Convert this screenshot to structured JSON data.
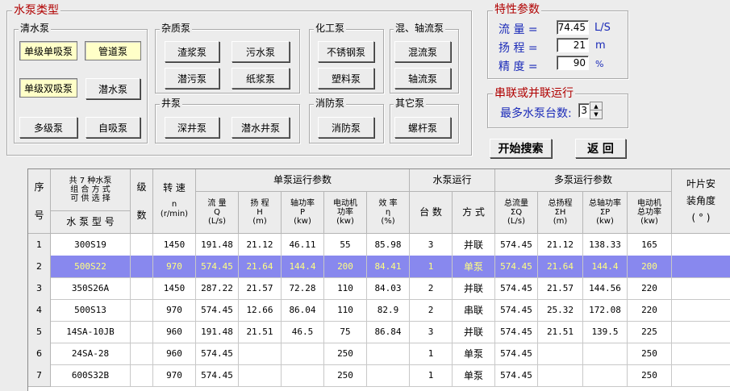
{
  "type_group": {
    "title": "水泵类型",
    "clear_water": {
      "title": "清水泵",
      "buttons": [
        "单级单吸泵",
        "管道泵",
        "单级双吸泵",
        "潜水泵",
        "多级泵",
        "自吸泵"
      ]
    },
    "impurity": {
      "title": "杂质泵",
      "buttons": [
        "渣浆泵",
        "污水泵",
        "潜污泵",
        "纸浆泵"
      ]
    },
    "chemical": {
      "title": "化工泵",
      "buttons": [
        "不锈钢泵",
        "塑料泵"
      ]
    },
    "mixed_flow": {
      "title": "混、轴流泵",
      "buttons": [
        "混流泵",
        "轴流泵"
      ]
    },
    "well": {
      "title": "井泵",
      "buttons": [
        "深井泵",
        "潜水井泵"
      ]
    },
    "fire": {
      "title": "消防泵",
      "buttons": [
        "消防泵"
      ]
    },
    "other": {
      "title": "其它泵",
      "buttons": [
        "螺杆泵"
      ]
    }
  },
  "params": {
    "title": "特性参数",
    "flow_label": "流  量 =",
    "flow_value": "74.45",
    "flow_unit": "L/S",
    "head_label": "扬  程 =",
    "head_value": "21",
    "head_unit": "m",
    "accuracy_label": "精  度 =",
    "accuracy_value": "90",
    "accuracy_unit": "%"
  },
  "series": {
    "title": "串联或并联运行",
    "max_label": "最多水泵台数:",
    "max_value": "3"
  },
  "actions": {
    "search": "开始搜索",
    "back": "返  回"
  },
  "table": {
    "headers": {
      "seq_top": "序",
      "seq_bottom": "号",
      "combo_top": "共 7 种水泵\n组 合 方 式\n可 供 选 择",
      "model": "水 泵 型 号",
      "stage_top": "级",
      "stage_bottom": "数",
      "speed_top": "转  速",
      "speed_bottom": "n\n(r/min)",
      "single": "单泵运行参数",
      "flow": "流  量\nQ\n(L/s)",
      "head": "扬  程\nH\n(m)",
      "shaft": "轴功率\nP\n(kw)",
      "motor": "电动机\n功率\n(kw)",
      "eff": "效  率\nη\n(%)",
      "run": "水泵运行",
      "count": "台  数",
      "mode": "方  式",
      "multi": "多泵运行参数",
      "tflow": "总流量\nΣQ\n(L/s)",
      "thead": "总扬程\nΣH\n(m)",
      "tshaft": "总轴功率\nΣP\n(kw)",
      "tmotor": "电动机\n总功率\n(kw)",
      "blade_top": "叶片安",
      "blade_mid": "装角度",
      "blade_bottom": "( ° )"
    },
    "rows": [
      {
        "no": "1",
        "model": "300S19",
        "stage": "",
        "speed": "1450",
        "q": "191.48",
        "h": "21.12",
        "p": "46.11",
        "motor": "55",
        "eff": "85.98",
        "count": "3",
        "mode": "并联",
        "tq": "574.45",
        "th": "21.12",
        "tp": "138.33",
        "tm": "165",
        "blade": ""
      },
      {
        "no": "2",
        "model": "500S22",
        "stage": "",
        "speed": "970",
        "q": "574.45",
        "h": "21.64",
        "p": "144.4",
        "motor": "200",
        "eff": "84.41",
        "count": "1",
        "mode": "单泵",
        "tq": "574.45",
        "th": "21.64",
        "tp": "144.4",
        "tm": "200",
        "blade": ""
      },
      {
        "no": "3",
        "model": "350S26A",
        "stage": "",
        "speed": "1450",
        "q": "287.22",
        "h": "21.57",
        "p": "72.28",
        "motor": "110",
        "eff": "84.03",
        "count": "2",
        "mode": "并联",
        "tq": "574.45",
        "th": "21.57",
        "tp": "144.56",
        "tm": "220",
        "blade": ""
      },
      {
        "no": "4",
        "model": "500S13",
        "stage": "",
        "speed": "970",
        "q": "574.45",
        "h": "12.66",
        "p": "86.04",
        "motor": "110",
        "eff": "82.9",
        "count": "2",
        "mode": "串联",
        "tq": "574.45",
        "th": "25.32",
        "tp": "172.08",
        "tm": "220",
        "blade": ""
      },
      {
        "no": "5",
        "model": "14SA-10JB",
        "stage": "",
        "speed": "960",
        "q": "191.48",
        "h": "21.51",
        "p": "46.5",
        "motor": "75",
        "eff": "86.84",
        "count": "3",
        "mode": "并联",
        "tq": "574.45",
        "th": "21.51",
        "tp": "139.5",
        "tm": "225",
        "blade": ""
      },
      {
        "no": "6",
        "model": "24SA-28",
        "stage": "",
        "speed": "960",
        "q": "574.45",
        "h": "",
        "p": "",
        "motor": "250",
        "eff": "",
        "count": "1",
        "mode": "单泵",
        "tq": "574.45",
        "th": "",
        "tp": "",
        "tm": "250",
        "blade": ""
      },
      {
        "no": "7",
        "model": "600S32B",
        "stage": "",
        "speed": "970",
        "q": "574.45",
        "h": "",
        "p": "",
        "motor": "250",
        "eff": "",
        "count": "1",
        "mode": "单泵",
        "tq": "574.45",
        "th": "",
        "tp": "",
        "tm": "250",
        "blade": ""
      }
    ],
    "selected_row": 2
  }
}
